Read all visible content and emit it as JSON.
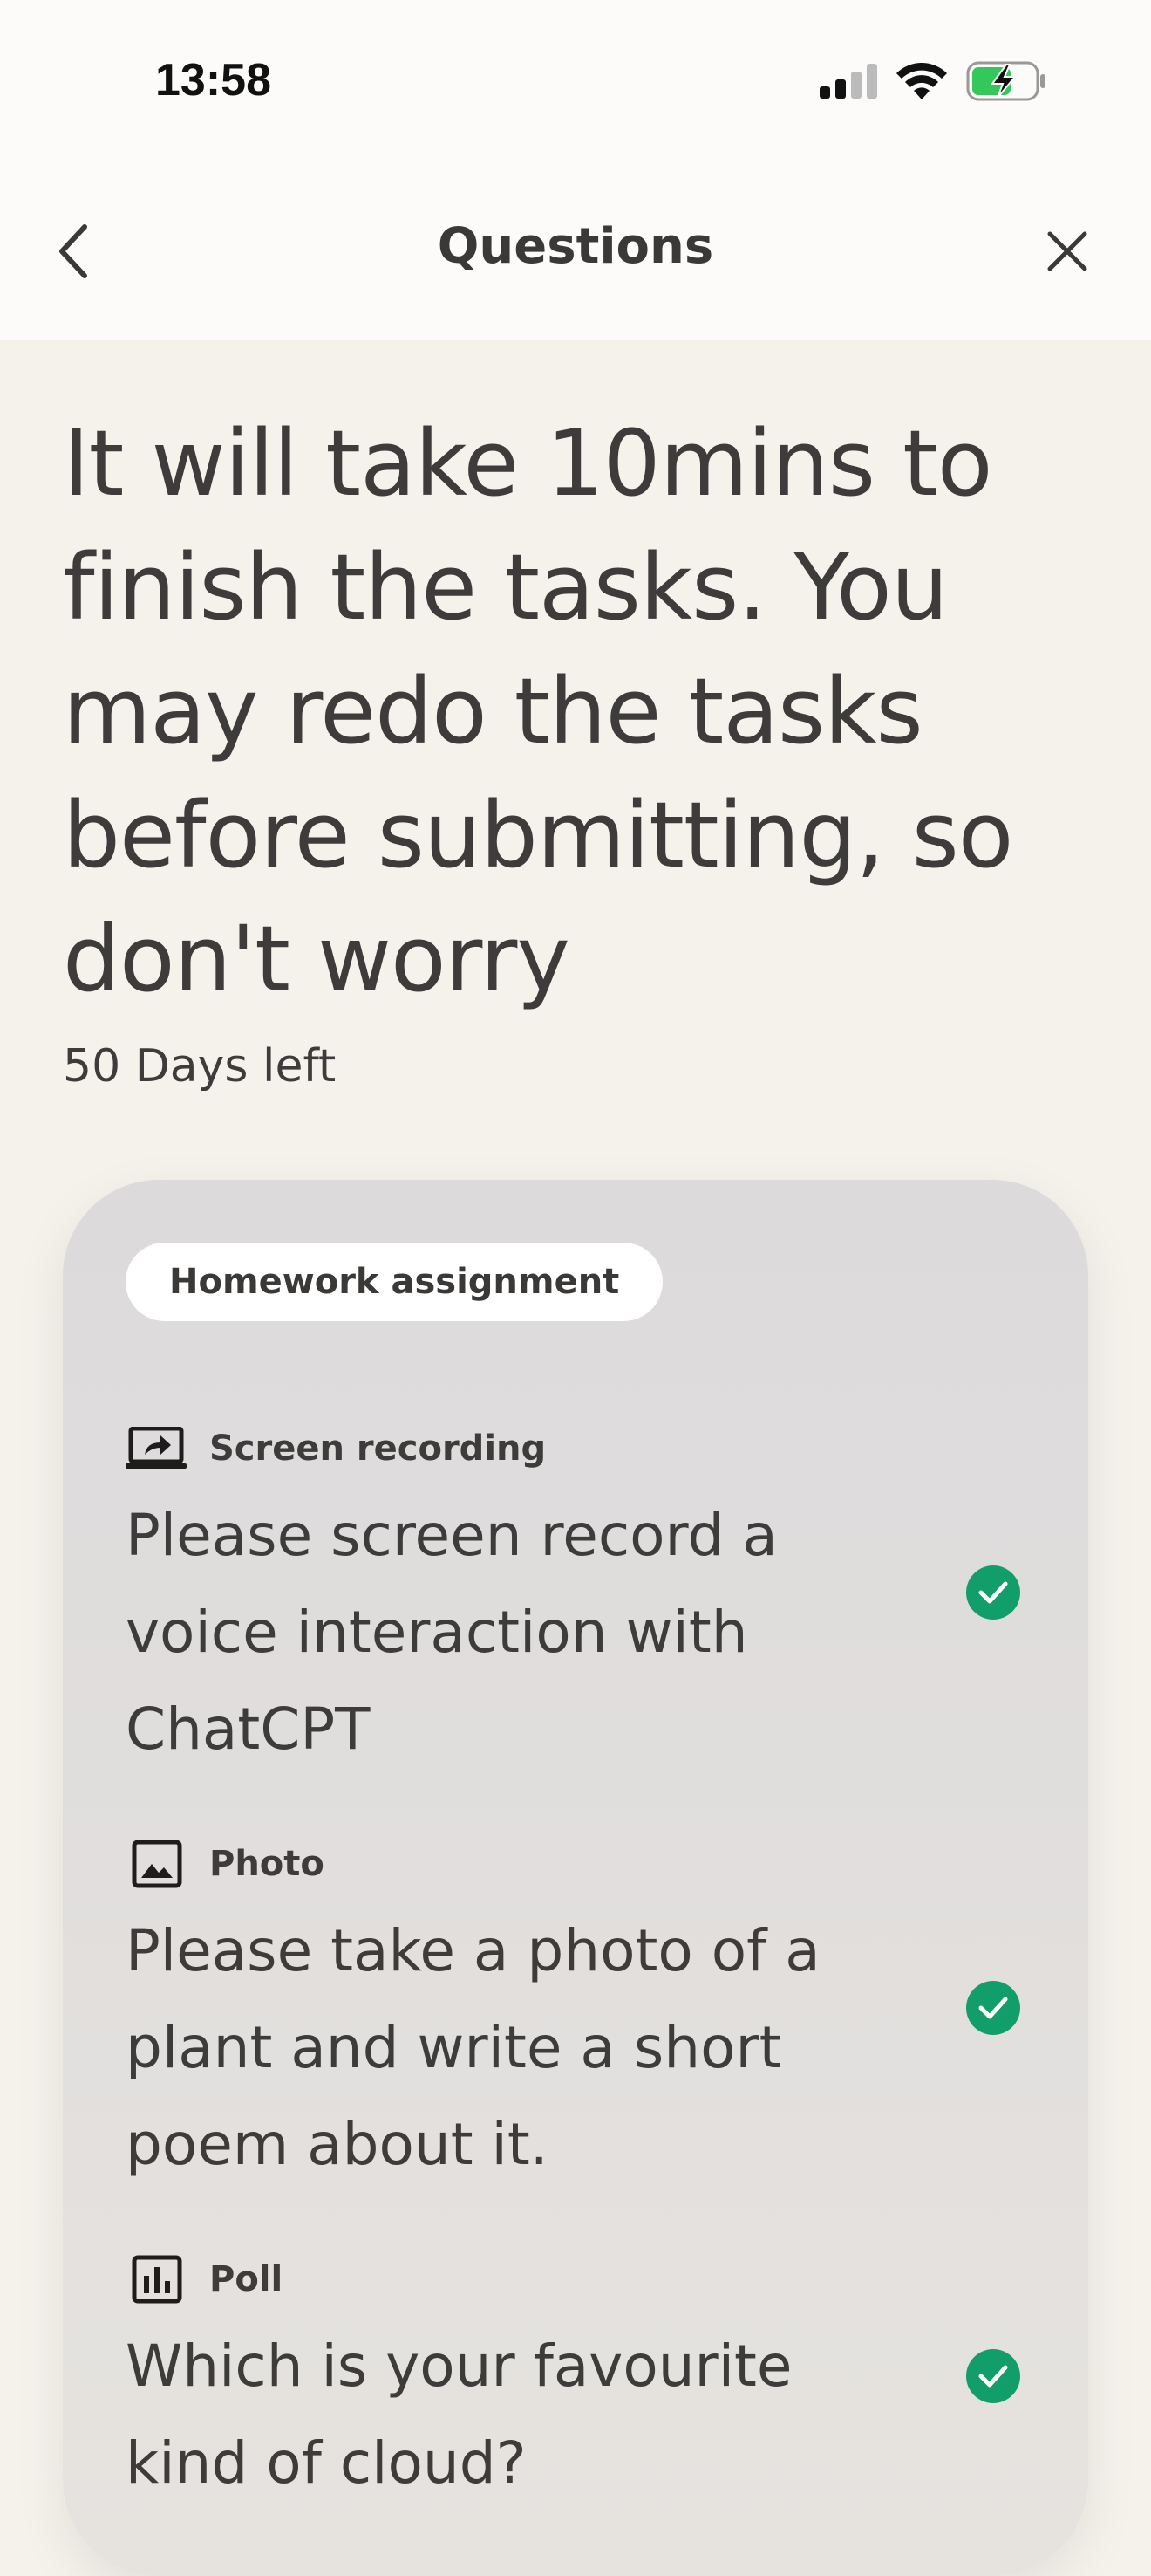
{
  "status_bar": {
    "time": "13:58"
  },
  "nav": {
    "title": "Questions",
    "back_icon": "chevron-left-icon",
    "close_icon": "close-icon"
  },
  "intro": {
    "heading": "It will take 10mins to finish the tasks. You may redo the tasks before submitting, so don't worry",
    "deadline": "50 Days left"
  },
  "assignment": {
    "badge": "Homework assignment",
    "tasks": [
      {
        "type": "Screen recording",
        "icon": "screen-share-icon",
        "text": "Please screen record a voice interaction with ChatCPT",
        "completed": true
      },
      {
        "type": "Photo",
        "icon": "image-icon",
        "text": "Please take a photo of a plant and write a short poem about it.",
        "completed": true
      },
      {
        "type": "Poll",
        "icon": "poll-chart-icon",
        "text": "Which is your favourite kind of cloud?",
        "completed": true
      }
    ]
  },
  "colors": {
    "check": "#119e6b",
    "background": "#f5f2ec",
    "battery": "#34c759"
  }
}
